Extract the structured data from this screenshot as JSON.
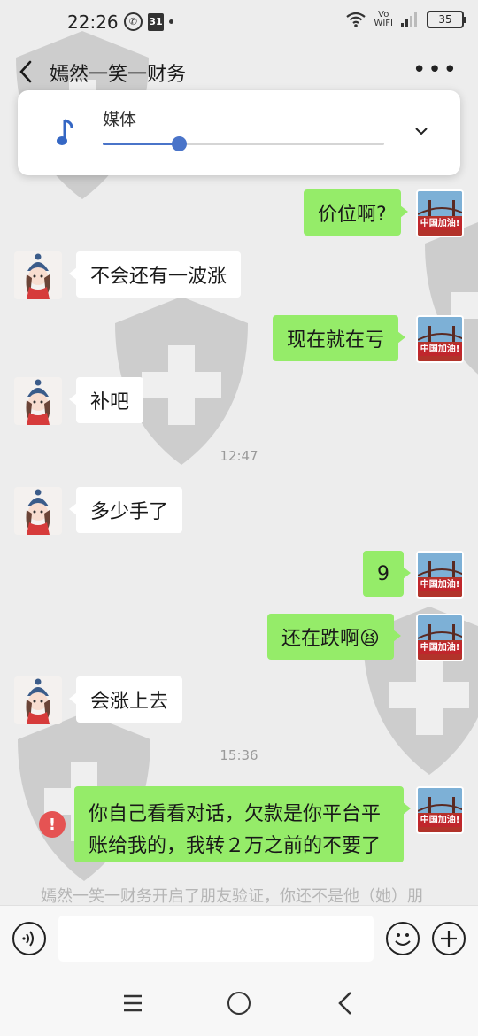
{
  "status_bar": {
    "time": "22:26",
    "calendar_day": "31",
    "vowifi_line1": "Vo",
    "vowifi_line2": "WIFI",
    "battery": "35"
  },
  "header": {
    "title": "嫣然一笑一财务"
  },
  "volume_panel": {
    "label": "媒体",
    "level_percent": 27
  },
  "avatar_me_caption": "中国加油!",
  "messages": [
    {
      "side": "out",
      "text": "价位啊?"
    },
    {
      "side": "in",
      "text": "不会还有一波涨"
    },
    {
      "side": "out",
      "text": "现在就在亏"
    },
    {
      "side": "in",
      "text": "补吧"
    },
    {
      "type": "time",
      "text": "12:47"
    },
    {
      "side": "in",
      "text": "多少手了"
    },
    {
      "side": "out",
      "text": "9"
    },
    {
      "side": "out",
      "text": "还在跌啊😫"
    },
    {
      "side": "in",
      "text": "会涨上去"
    },
    {
      "type": "time",
      "text": "15:36"
    },
    {
      "side": "out",
      "text": "你自己看看对话，欠款是你平台平账给我的，我转２万之前的不要了",
      "failed": true
    }
  ],
  "error_icon_glyph": "!",
  "system_notice": "嫣然一笑一财务开启了朋友验证，你还不是他（她）朋",
  "input_bar": {
    "placeholder": ""
  }
}
